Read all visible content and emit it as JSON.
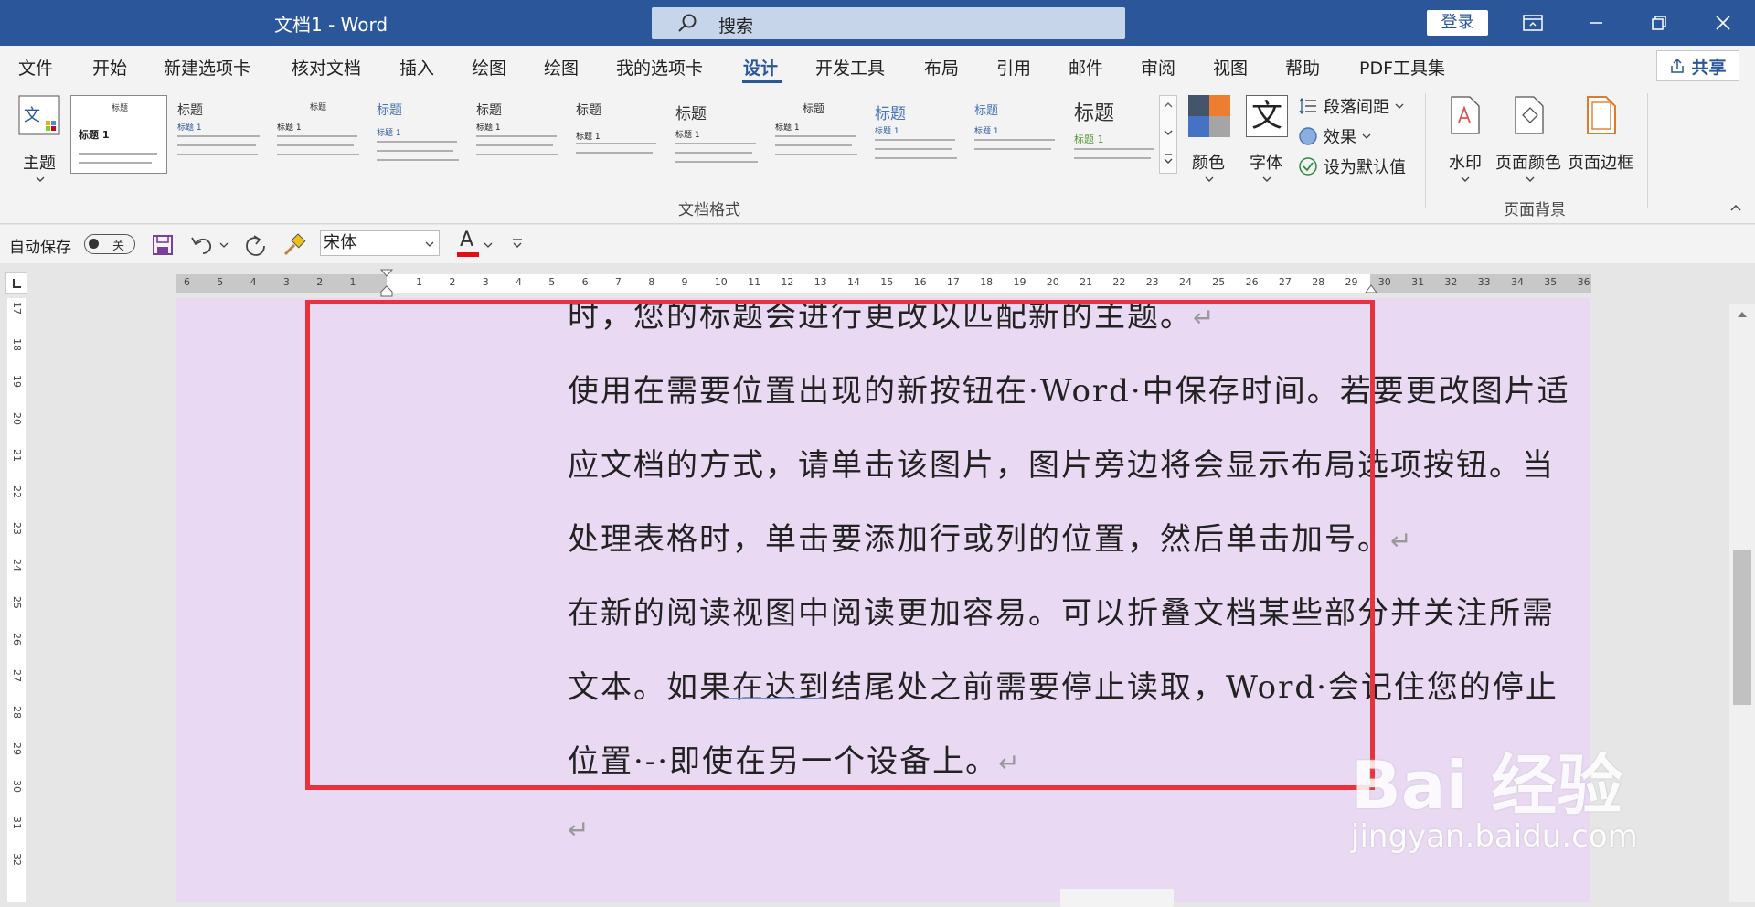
{
  "titlebar": {
    "doc_title": "文档1  -  Word",
    "search_placeholder": "搜索",
    "login_label": "登录"
  },
  "tabs": [
    "文件",
    "开始",
    "新建选项卡",
    "核对文档",
    "插入",
    "绘图",
    "绘图",
    "我的选项卡",
    "设计",
    "开发工具",
    "布局",
    "引用",
    "邮件",
    "审阅",
    "视图",
    "帮助",
    "PDF工具集"
  ],
  "active_tab": "设计",
  "share_label": "共享",
  "ribbon": {
    "theme_label": "主题",
    "gallery_titles": [
      "标题",
      "标题",
      "标题",
      "标题",
      "标题",
      "标题",
      "标题",
      "标题",
      "标题",
      "标题",
      "标题"
    ],
    "gallery_first_head": "标题 1",
    "colors_label": "颜色",
    "fonts_label": "字体",
    "font_glyph": "文",
    "para_spacing_label": "段落间距",
    "effects_label": "效果",
    "set_default_label": "设为默认值",
    "group_doc_format": "文档格式",
    "watermark_label": "水印",
    "page_color_label": "页面颜色",
    "page_border_label": "页面边框",
    "group_page_bg": "页面背景"
  },
  "qat": {
    "autosave_label": "自动保存",
    "autosave_state": "关",
    "font_name": "宋体",
    "font_color_glyph": "A"
  },
  "ruler_numbers": [
    "6",
    "5",
    "4",
    "3",
    "2",
    "1",
    "",
    "1",
    "2",
    "3",
    "4",
    "5",
    "6",
    "7",
    "8",
    "9",
    "10",
    "11",
    "12",
    "13",
    "14",
    "15",
    "16",
    "17",
    "18",
    "19",
    "20",
    "21",
    "22",
    "23",
    "24",
    "25",
    "26",
    "27",
    "28",
    "29",
    "30",
    "31",
    "32",
    "33",
    "34",
    "35",
    "36"
  ],
  "vruler_numbers": [
    "17",
    "18",
    "19",
    "20",
    "21",
    "22",
    "23",
    "24",
    "25",
    "26",
    "27",
    "28",
    "29",
    "30",
    "31",
    "32"
  ],
  "document": {
    "lines": [
      "时，您的标题会进行更改以匹配新的主题。",
      "使用在需要位置出现的新按钮在·Word·中保存时间。若要更改图片适",
      "应文档的方式，请单击该图片，图片旁边将会显示布局选项按钮。当",
      "处理表格时，单击要添加行或列的位置，然后单击加号。",
      "在新的阅读视图中阅读更加容易。可以折叠文档某些部分并关注所需",
      "文本。如果在达到结尾处之前需要停止读取，Word·会记住您的停止",
      "位置·-·即使在另一个设备上。"
    ],
    "para_mark": "↵"
  },
  "watermark": {
    "logo_text": "Bai 经验",
    "url": "jingyan.baidu.com"
  },
  "colors": {
    "title_bar": "#2b579a",
    "highlight": "#e8333d",
    "page_bg": "#e9d9f3"
  }
}
